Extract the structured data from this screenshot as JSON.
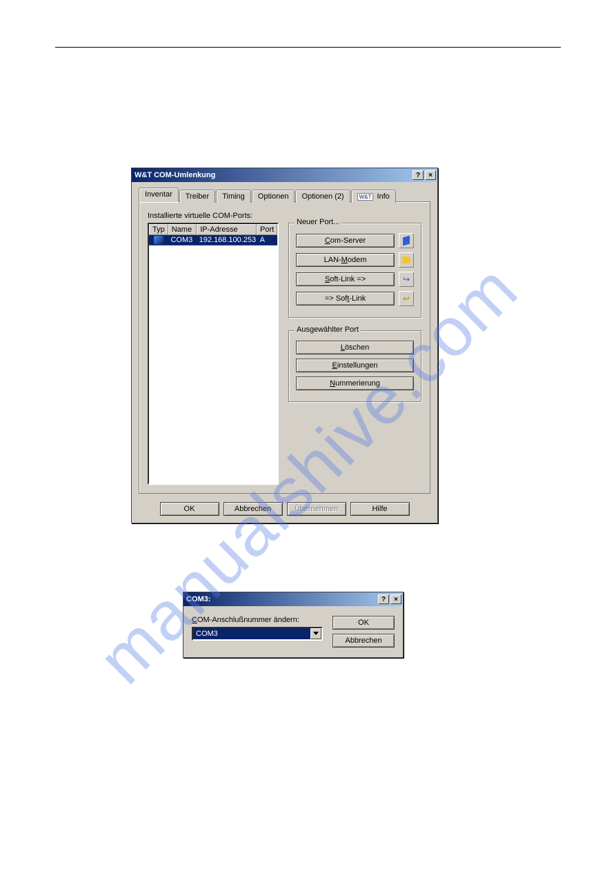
{
  "page": {
    "watermark": "manualshive.com"
  },
  "mainDialog": {
    "title": "W&T COM-Umlenkung",
    "tabs": [
      "Inventar",
      "Treiber",
      "Timing",
      "Optionen",
      "Optionen (2)",
      "Info"
    ],
    "info_badge": "W&T",
    "installed_label": "Installierte virtuelle COM-Ports:",
    "columns": {
      "c1": "Typ",
      "c2": "Name",
      "c3": "IP-Adresse",
      "c4": "Port"
    },
    "rows": [
      {
        "name": "COM3",
        "ip": "192.168.100.253",
        "port": "A"
      }
    ],
    "new_port": {
      "legend": "Neuer Port...",
      "com_server": "Com-Server",
      "lan_modem": "LAN-Modem",
      "softlink_out": "Soft-Link =>",
      "softlink_in": "=> Soft-Link"
    },
    "selected_port": {
      "legend": "Ausgewählter Port",
      "delete": "Löschen",
      "settings": "Einstellungen",
      "numbering": "Nummerierung"
    },
    "buttons": {
      "ok": "OK",
      "cancel": "Abbrechen",
      "apply": "Übernehmen",
      "help": "Hilfe"
    }
  },
  "smallDialog": {
    "title": "COM3:",
    "label": "COM-Anschlußnummer ändern:",
    "value": "COM3",
    "ok": "OK",
    "cancel": "Abbrechen"
  }
}
